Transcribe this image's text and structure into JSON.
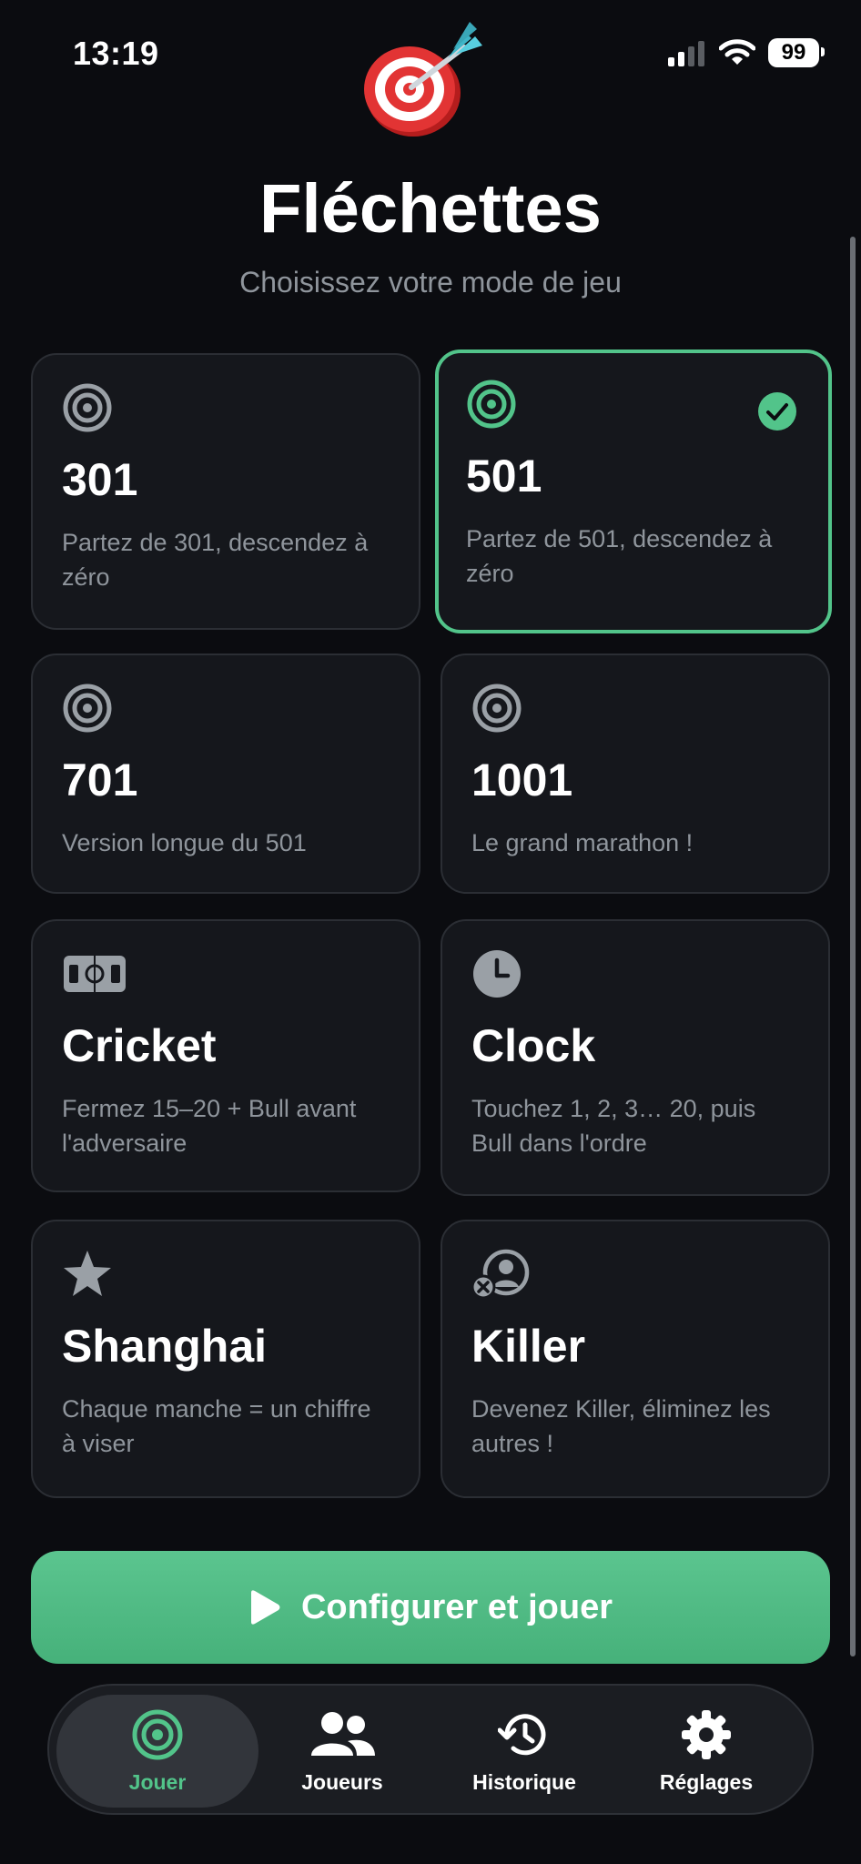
{
  "status": {
    "time": "13:19",
    "battery": "99"
  },
  "header": {
    "title": "Fléchettes",
    "subtitle": "Choisissez votre mode de jeu"
  },
  "modes": [
    {
      "name": "301",
      "desc": "Partez de 301, descendez à zéro",
      "icon": "target-icon",
      "selected": false
    },
    {
      "name": "501",
      "desc": "Partez de 501, descendez à zéro",
      "icon": "target-icon",
      "selected": true
    },
    {
      "name": "701",
      "desc": "Version longue du 501",
      "icon": "target-icon",
      "selected": false
    },
    {
      "name": "1001",
      "desc": "Le grand marathon !",
      "icon": "target-icon",
      "selected": false
    },
    {
      "name": "Cricket",
      "desc": "Fermez 15–20 + Bull avant l'adversaire",
      "icon": "cricket-field-icon",
      "selected": false
    },
    {
      "name": "Clock",
      "desc": "Touchez 1, 2, 3… 20, puis Bull dans l'ordre",
      "icon": "clock-icon",
      "selected": false
    },
    {
      "name": "Shanghai",
      "desc": "Chaque manche = un chiffre à viser",
      "icon": "star-icon",
      "selected": false
    },
    {
      "name": "Killer",
      "desc": "Devenez Killer, éliminez les autres !",
      "icon": "person-x-icon",
      "selected": false
    }
  ],
  "cta": {
    "label": "Configurer et jouer",
    "icon": "play-icon"
  },
  "tabs": [
    {
      "label": "Jouer",
      "icon": "target-icon",
      "active": true
    },
    {
      "label": "Joueurs",
      "icon": "people-icon",
      "active": false
    },
    {
      "label": "Historique",
      "icon": "history-icon",
      "active": false
    },
    {
      "label": "Réglages",
      "icon": "gear-icon",
      "active": false
    }
  ],
  "colors": {
    "accent": "#52c48a",
    "background": "#0b0c10",
    "card": "#15171c",
    "muted": "#8f959c"
  }
}
